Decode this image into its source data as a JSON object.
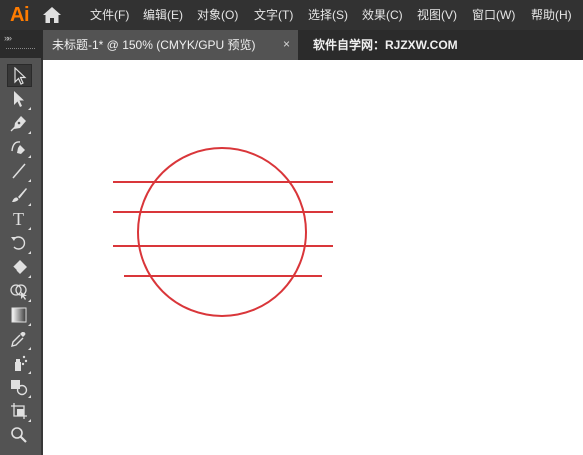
{
  "app": {
    "logo_text": "Ai",
    "brand_color": "#ff7c00"
  },
  "menu": {
    "items": [
      {
        "label": "文件(F)"
      },
      {
        "label": "编辑(E)"
      },
      {
        "label": "对象(O)"
      },
      {
        "label": "文字(T)"
      },
      {
        "label": "选择(S)"
      },
      {
        "label": "效果(C)"
      },
      {
        "label": "视图(V)"
      },
      {
        "label": "窗口(W)"
      },
      {
        "label": "帮助(H)"
      }
    ]
  },
  "tabs": {
    "active": {
      "title": "未标题-1* @ 150% (CMYK/GPU 预览)",
      "close": "×"
    },
    "inactive": {
      "title": "软件自学网：RJZXW.COM"
    }
  },
  "toolbar": {
    "collapse": "»»",
    "tools": [
      {
        "icon": "selection-tool-icon"
      },
      {
        "icon": "direct-selection-tool-icon"
      },
      {
        "icon": "pen-tool-icon"
      },
      {
        "icon": "curvature-tool-icon"
      },
      {
        "icon": "line-segment-tool-icon"
      },
      {
        "icon": "paintbrush-tool-icon"
      },
      {
        "icon": "type-tool-icon",
        "glyph": "T"
      },
      {
        "icon": "rotate-tool-icon"
      },
      {
        "icon": "eraser-tool-icon"
      },
      {
        "icon": "shape-builder-tool-icon"
      },
      {
        "icon": "gradient-tool-icon"
      },
      {
        "icon": "eyedropper-tool-icon"
      },
      {
        "icon": "symbol-sprayer-tool-icon"
      },
      {
        "icon": "live-paint-tool-icon"
      },
      {
        "icon": "artboard-tool-icon"
      },
      {
        "icon": "zoom-tool-icon"
      }
    ]
  },
  "artwork": {
    "stroke_color": "#d9363a"
  }
}
